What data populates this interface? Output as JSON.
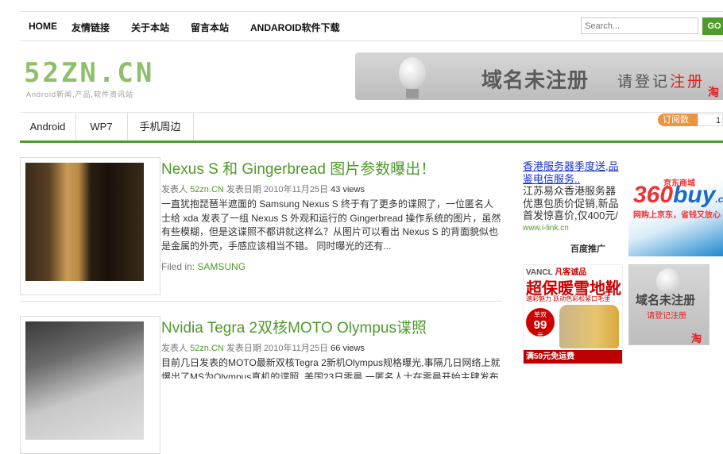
{
  "topnav": {
    "items": [
      "HOME",
      "友情链接",
      "关于本站",
      "留言本站",
      "ANDAROID软件下载"
    ],
    "search_placeholder": "Search...",
    "go_label": "GO"
  },
  "logo": {
    "text": "52ZN.CN",
    "tagline": "Android新闻,产品,软件资讯站"
  },
  "header_ad": {
    "main": "域名未注册",
    "sub_prefix": "请登记",
    "sub_red": "注册",
    "corner": "淘"
  },
  "catnav": {
    "items": [
      "Android",
      "WP7",
      "手机周边"
    ]
  },
  "subscribe": {
    "label": "订阅数",
    "count": "1"
  },
  "posts": [
    {
      "title": "Nexus S 和 Gingerbread 图片参数曝出！",
      "author_label": "发表人",
      "author": "52zn.CN",
      "date_label": "发表日期",
      "date": "2010年11月25日",
      "views": "43 views",
      "excerpt": "一直犹抱琵琶半遮面的 Samsung Nexus S 终于有了更多的谍照了，一位匿名人士给 xda 发表了一组 Nexus S 外观和运行的 Gingerbread 操作系统的图片，虽然有些模糊，但是这谍照不都讲就这样么？从图片可以看出 Nexus S 的背面貌似也是金属的外壳，手感应该相当不错。 同时曝光的还有...",
      "filed_label": "Filed in:",
      "category": "SAMSUNG"
    },
    {
      "title": "Nvidia Tegra 2双核MOTO Olympus谍照",
      "author_label": "发表人",
      "author": "52zn.CN",
      "date_label": "发表日期",
      "date": "2010年11月25日",
      "views": "66 views",
      "excerpt": "目前几日发表的MOTO最新双核Tegra 2新机Olympus规格曝光,事隔几日网络上就爆出了MS为Olympus真机的谍照, 美国23日零晨 一匿名人士在零晨开始主肆发布"
    }
  ],
  "sidebar": {
    "text_ad": {
      "line1": "香港服务器季度送,品鉴电信服务..",
      "body": "江苏易众香港服务器优惠包质价促销,新品首发惊喜价,仅400元/",
      "url": "www.i-link.cn",
      "baidu": "百度推广"
    },
    "ad360": {
      "jd": "京东商城",
      "logo_a": "360",
      "logo_b": "buy",
      "logo_c": ".com",
      "slogan": "网购上京东，省钱又放心"
    },
    "vancl": {
      "brand": "VANCL",
      "brand2": "凡客诚品",
      "headline": "超保暖雪地靴",
      "small": "速彩魅力 跃动色彩松紧口毛里",
      "price_label": "单双",
      "price": "99",
      "price_unit": "元",
      "footer": "满59元免运费"
    },
    "ad2": {
      "main": "域名未注册",
      "sub_prefix": "请登记",
      "sub_red": "注册",
      "corner": "淘"
    }
  },
  "colors": {
    "accent": "#4f9a2b",
    "link_blue": "#1a33cc",
    "subscribe_orange": "#e99441"
  }
}
